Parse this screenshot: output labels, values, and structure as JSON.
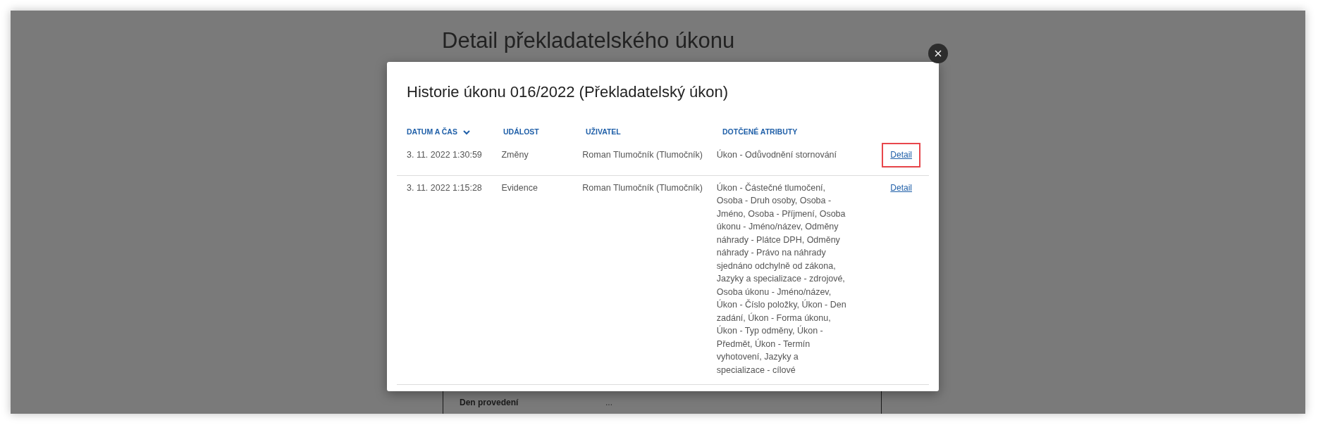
{
  "page": {
    "title": "Detail překladatelského úkonu",
    "panel_row": {
      "label": "Den provedení",
      "value": "..."
    }
  },
  "modal": {
    "title": "Historie úkonu 016/2022 (Překladatelský úkon)",
    "columns": [
      {
        "label": "DATUM A ČAS",
        "sorted": true
      },
      {
        "label": "UDÁLOST",
        "sorted": false
      },
      {
        "label": "UŽIVATEL",
        "sorted": false
      },
      {
        "label": "DOTČENÉ ATRIBUTY",
        "sorted": false
      }
    ],
    "rows": [
      {
        "date": "3. 11. 2022 1:30:59",
        "event": "Změny",
        "user": "Roman Tlumočník (Tlumočník)",
        "attributes": "Úkon - Odůvodnění stornování",
        "link": "Detail",
        "highlighted": true
      },
      {
        "date": "3. 11. 2022 1:15:28",
        "event": "Evidence",
        "user": "Roman Tlumočník (Tlumočník)",
        "attributes": "Úkon - Částečné tlumočení, Osoba - Druh osoby, Osoba - Jméno, Osoba - Příjmení, Osoba úkonu - Jméno/název, Odměny náhrady - Plátce DPH, Odměny náhrady - Právo na náhrady sjednáno odchylně od zákona, Jazyky a specializace - zdrojové, Osoba úkonu - Jméno/název, Úkon - Číslo položky, Úkon - Den zadání, Úkon - Forma úkonu, Úkon - Typ odměny, Úkon - Předmět, Úkon - Termín vyhotovení, Jazyky a specializace - cílové",
        "link": "Detail",
        "highlighted": false
      }
    ]
  }
}
